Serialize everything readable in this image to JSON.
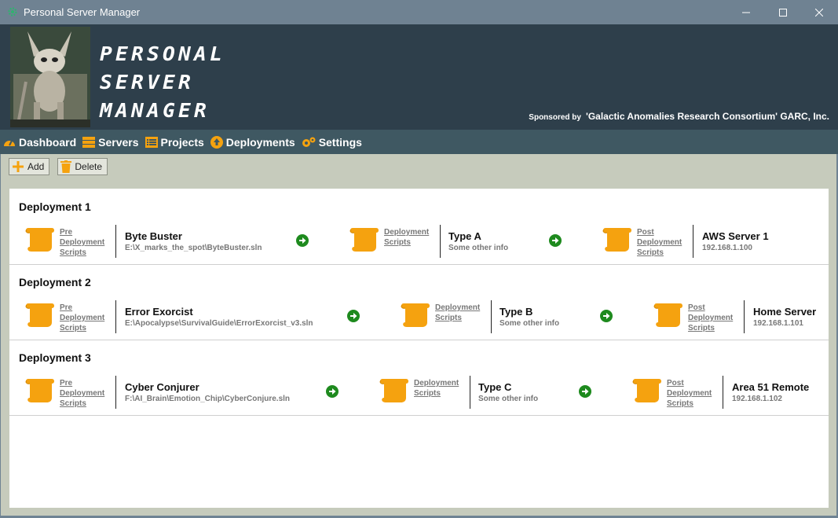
{
  "window": {
    "title": "Personal Server Manager"
  },
  "header": {
    "logo_line1": "PERSONAL",
    "logo_line2": "SERVER",
    "logo_line3": "MANAGER",
    "sponsored_by": "Sponsored by",
    "sponsor_name": "'Galactic Anomalies Research Consortium' GARC, Inc."
  },
  "nav": {
    "items": [
      {
        "label": "Dashboard",
        "icon": "gauge-icon"
      },
      {
        "label": "Servers",
        "icon": "server-stack-icon"
      },
      {
        "label": "Projects",
        "icon": "list-icon"
      },
      {
        "label": "Deployments",
        "icon": "upload-circle-icon"
      },
      {
        "label": "Settings",
        "icon": "gears-icon"
      }
    ]
  },
  "toolbar": {
    "add_label": "Add",
    "delete_label": "Delete"
  },
  "deployments": [
    {
      "title": "Deployment 1",
      "pre_link": "Pre\nDeployment\nScripts",
      "project_name": "Byte Buster",
      "project_path": "E:\\X_marks_the_spot\\ByteBuster.sln",
      "deploy_link": "Deployment\nScripts",
      "type_name": "Type A",
      "type_info": "Some other info",
      "post_link": "Post\nDeployment\nScripts",
      "server_name": "AWS Server 1",
      "server_ip": "192.168.1.100"
    },
    {
      "title": "Deployment 2",
      "pre_link": "Pre\nDeployment\nScripts",
      "project_name": "Error Exorcist",
      "project_path": "E:\\Apocalypse\\SurvivalGuide\\ErrorExorcist_v3.sln",
      "deploy_link": "Deployment\nScripts",
      "type_name": "Type B",
      "type_info": "Some other info",
      "post_link": "Post\nDeployment\nScripts",
      "server_name": "Home Server",
      "server_ip": "192.168.1.101"
    },
    {
      "title": "Deployment 3",
      "pre_link": "Pre\nDeployment\nScripts",
      "project_name": "Cyber Conjurer",
      "project_path": "F:\\AI_Brain\\Emotion_Chip\\CyberConjure.sln",
      "deploy_link": "Deployment\nScripts",
      "type_name": "Type C",
      "type_info": "Some other info",
      "post_link": "Post\nDeployment\nScripts",
      "server_name": "Area 51 Remote",
      "server_ip": "192.168.1.102"
    }
  ],
  "colors": {
    "accent_orange": "#f5a20f",
    "arrow_green": "#1e8a1e",
    "header_bg": "#2e3f4b",
    "nav_bg": "#3f5862"
  }
}
